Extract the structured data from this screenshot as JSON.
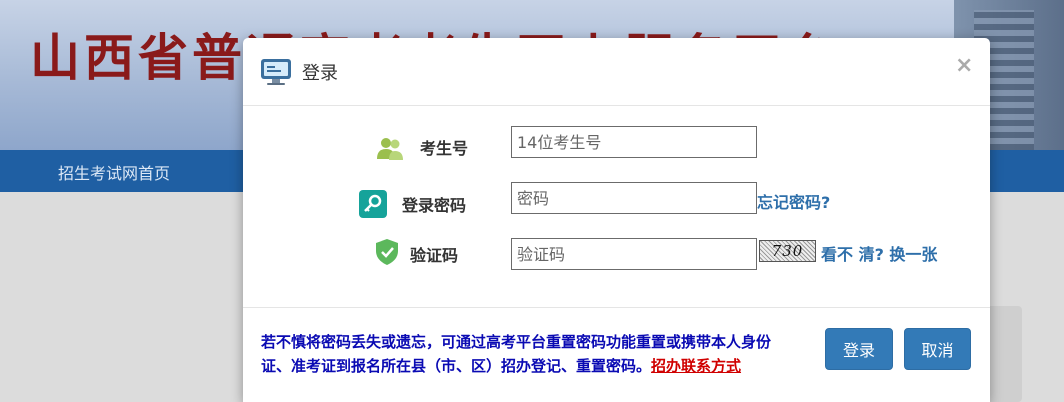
{
  "background": {
    "site_title": "山西省普通高考考生网上服务平台",
    "nav_item": "招生考试网首页"
  },
  "modal": {
    "title": "登录",
    "close": "×",
    "fields": {
      "exam_id": {
        "label": "考生号",
        "placeholder": "14位考生号"
      },
      "password": {
        "label": "登录密码",
        "placeholder": "密码"
      },
      "captcha": {
        "label": "验证码",
        "placeholder": "验证码",
        "image_text": "730"
      }
    },
    "forgot_password": "忘记密码?",
    "captcha_refresh": "看不 清? 换一张",
    "notice_text": "若不慎将密码丢失或遗忘，可通过高考平台重置密码功能重置或携带本人身份 证、准考证到报名所在县（市、区）招办登记、重置密码。",
    "notice_link": "招办联系方式",
    "buttons": {
      "login": "登录",
      "cancel": "取消"
    }
  },
  "colors": {
    "primary": "#337ab7",
    "link": "#2e6faa",
    "notice": "#0a0ab3",
    "notice_link": "#d00000",
    "nav": "#1f5fa3"
  },
  "icons": [
    "monitor-icon",
    "users-icon",
    "key-icon",
    "shield-check-icon"
  ]
}
